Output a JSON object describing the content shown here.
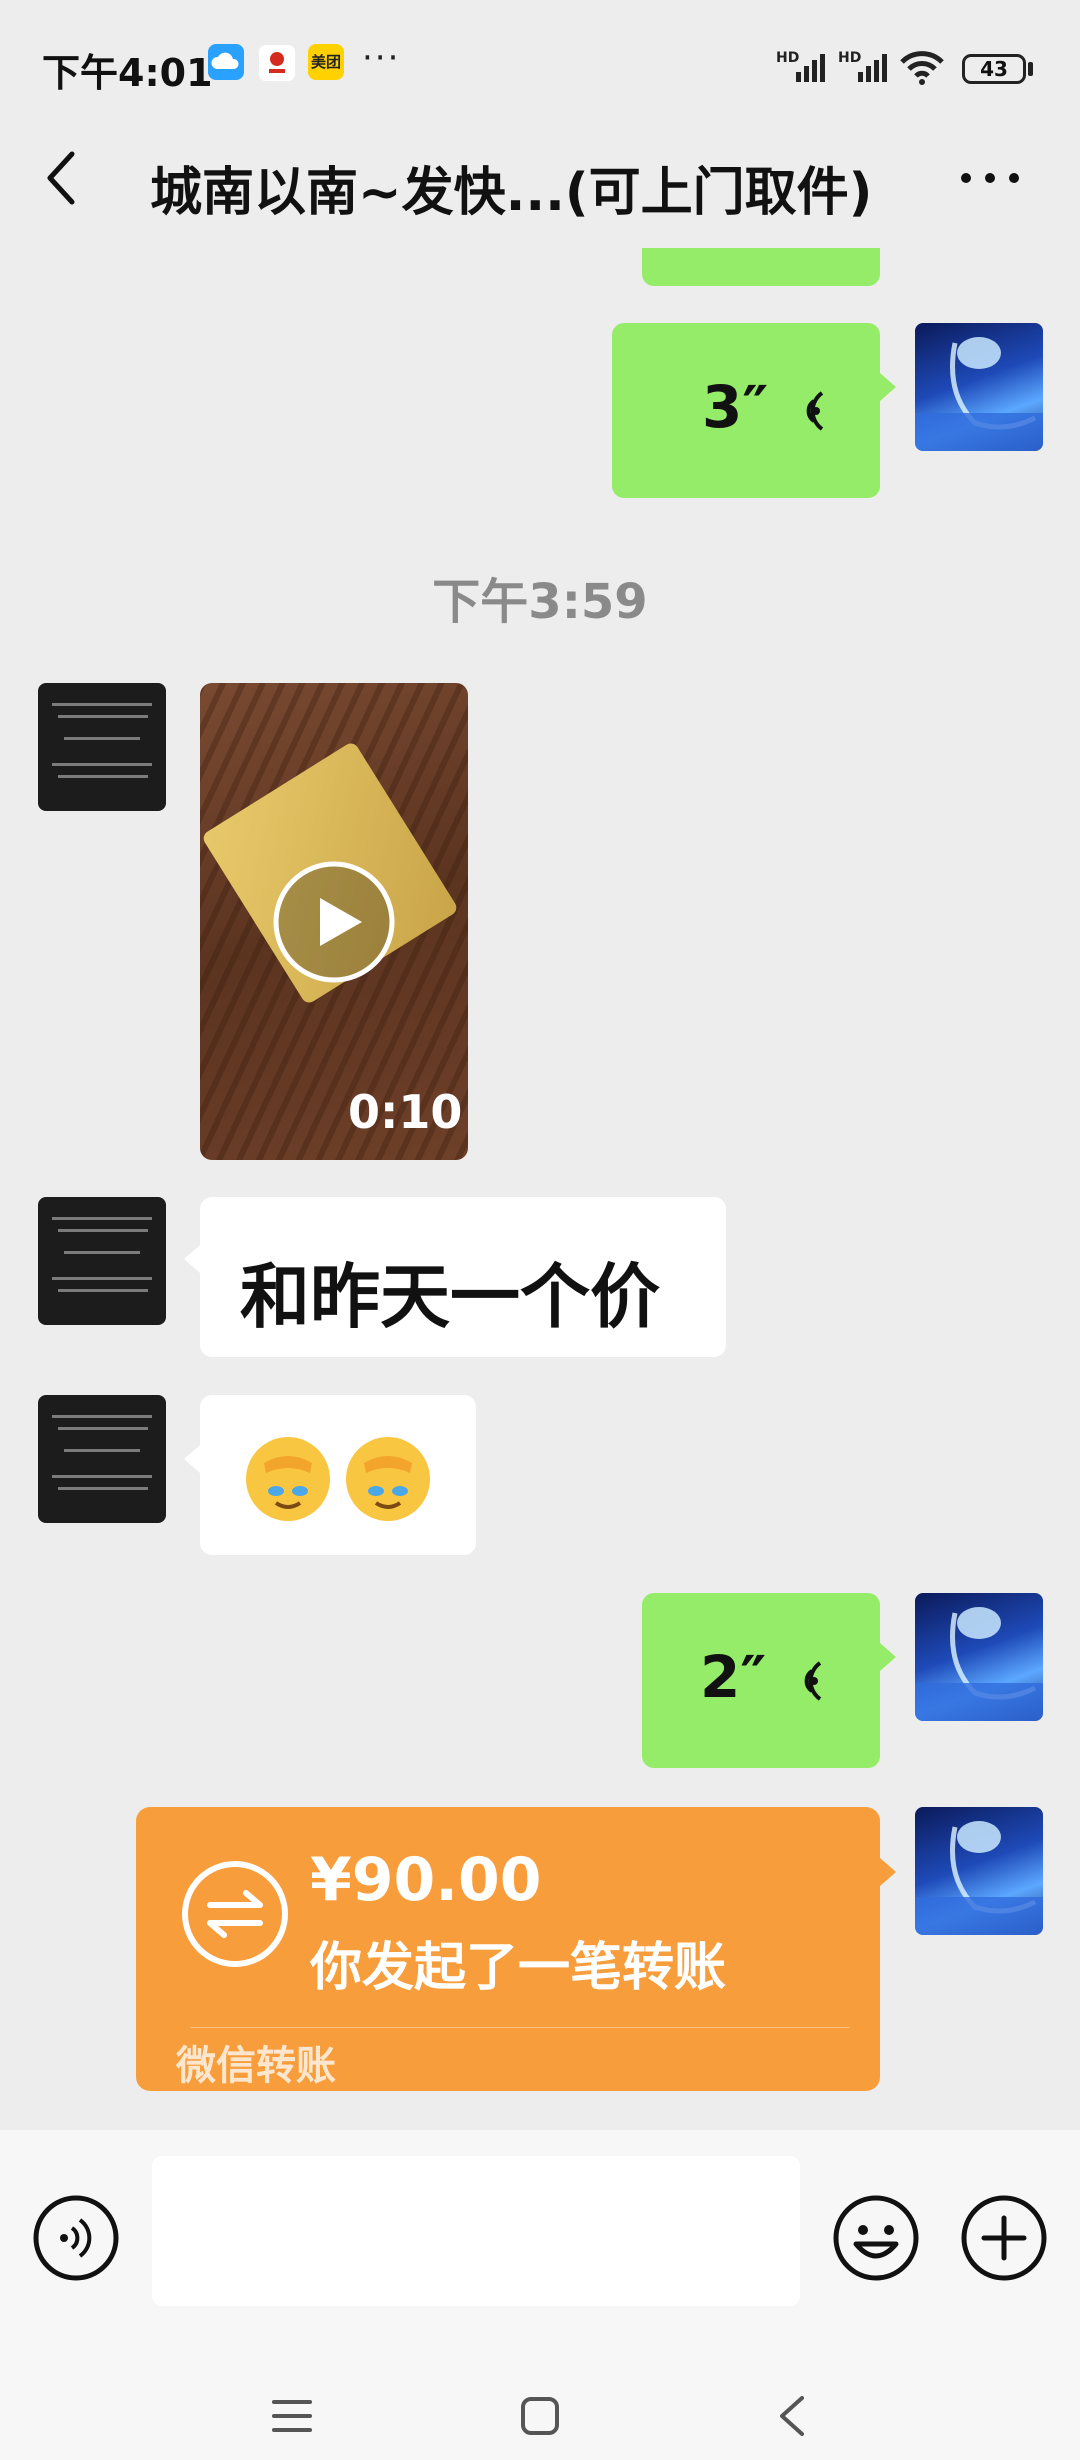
{
  "status_bar": {
    "time": "下午4:01",
    "app_icons": [
      "cloud-icon",
      "news-icon",
      "meituan-icon"
    ],
    "meituan_label": "美团",
    "more": "···",
    "signal_labels": [
      "HD",
      "HD"
    ],
    "battery": "43"
  },
  "header": {
    "title": "城南以南~发快...(可上门取件)"
  },
  "messages": [
    {
      "type": "voice",
      "from": "me",
      "duration": "3″"
    },
    {
      "type": "time",
      "text": "下午3:59"
    },
    {
      "type": "video",
      "from": "other",
      "duration": "0:10"
    },
    {
      "type": "text",
      "from": "other",
      "text": "和昨天一个价"
    },
    {
      "type": "emoji",
      "from": "other",
      "text": "🤦🤦"
    },
    {
      "type": "voice",
      "from": "me",
      "duration": "2″"
    },
    {
      "type": "transfer",
      "from": "me",
      "amount": "¥90.00",
      "desc": "你发起了一笔转账",
      "footer": "微信转账"
    }
  ],
  "colors": {
    "sent_bubble": "#95ec69",
    "received_bubble": "#ffffff",
    "transfer": "#f79d3c",
    "background": "#ededed"
  }
}
